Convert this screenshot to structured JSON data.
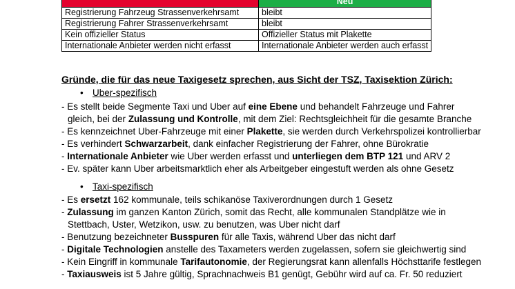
{
  "table": {
    "header": [
      "",
      "Neu"
    ],
    "rows": [
      [
        "Registrierung Fahrzeug Strassenverkehrsamt",
        "bleibt"
      ],
      [
        "Registrierung Fahrer Strassenverkehrsamt",
        "bleibt"
      ],
      [
        "Kein offizieller Status",
        "Offizieller Status mit Plakette"
      ],
      [
        "Internationale Anbieter werden nicht erfasst",
        "Internationale Anbieter werden auch erfasst"
      ]
    ]
  },
  "heading": "Gründe, die für das neue Taxigesetz sprechen, aus Sicht der TSZ, Taxisektion Zürich:",
  "sections": [
    {
      "bullet": "•",
      "title": "Uber-spezifisch",
      "lines": [
        {
          "indent": false,
          "segments": [
            {
              "t": "- Es stellt beide Segmente Taxi und Uber auf ",
              "b": false
            },
            {
              "t": "eine Ebene",
              "b": true
            },
            {
              "t": " und behandelt Fahrzeuge und Fahrer",
              "b": false
            }
          ]
        },
        {
          "indent": true,
          "segments": [
            {
              "t": "gleich, bei der ",
              "b": false
            },
            {
              "t": "Zulassung und Kontrolle",
              "b": true
            },
            {
              "t": ", mit dem Ziel: Rechtsgleichheit für die gesamte Branche",
              "b": false
            }
          ]
        },
        {
          "indent": false,
          "segments": [
            {
              "t": "- Es kennzeichnet Uber-Fahrzeuge mit einer ",
              "b": false
            },
            {
              "t": "Plakette",
              "b": true
            },
            {
              "t": ", sie werden durch Verkehrspolizei kontrollierbar",
              "b": false
            }
          ]
        },
        {
          "indent": false,
          "segments": [
            {
              "t": "- Es verhindert ",
              "b": false
            },
            {
              "t": "Schwarzarbeit",
              "b": true
            },
            {
              "t": ", dank einfacher Registrierung der Fahrer, ohne Bürokratie",
              "b": false
            }
          ]
        },
        {
          "indent": false,
          "segments": [
            {
              "t": "- ",
              "b": false
            },
            {
              "t": "Internationale Anbieter",
              "b": true
            },
            {
              "t": " wie Uber werden erfasst und ",
              "b": false
            },
            {
              "t": "unterliegen dem BTP 121",
              "b": true
            },
            {
              "t": " und ARV 2",
              "b": false
            }
          ]
        },
        {
          "indent": false,
          "segments": [
            {
              "t": "- Ev. später kann Uber arbeitsmarktlich eher als Arbeitgeber eingestuft werden als ohne Gesetz",
              "b": false
            }
          ]
        }
      ]
    },
    {
      "bullet": "•",
      "title": "Taxi-spezifisch",
      "lines": [
        {
          "indent": false,
          "segments": [
            {
              "t": "- Es ",
              "b": false
            },
            {
              "t": "ersetzt",
              "b": true
            },
            {
              "t": " 162 kommunale, teils schikanöse Taxiverordnungen durch 1 Gesetz",
              "b": false
            }
          ]
        },
        {
          "indent": false,
          "segments": [
            {
              "t": "- ",
              "b": false
            },
            {
              "t": "Zulassung",
              "b": true
            },
            {
              "t": " im ganzen Kanton Zürich, somit das Recht, alle kommunalen Standplätze wie in",
              "b": false
            }
          ]
        },
        {
          "indent": true,
          "segments": [
            {
              "t": "Stettbach, Uster, Wetzikon, usw. zu benutzen, was Uber nicht darf",
              "b": false
            }
          ]
        },
        {
          "indent": false,
          "segments": [
            {
              "t": "- Benutzung bezeichneter ",
              "b": false
            },
            {
              "t": "Busspuren",
              "b": true
            },
            {
              "t": " für alle Taxis, während Uber das nicht darf",
              "b": false
            }
          ]
        },
        {
          "indent": false,
          "segments": [
            {
              "t": "- ",
              "b": false
            },
            {
              "t": "Digitale Technologien",
              "b": true
            },
            {
              "t": " anstelle des Taxameters werden zugelassen, sofern sie gleichwertig sind",
              "b": false
            }
          ]
        },
        {
          "indent": false,
          "segments": [
            {
              "t": "- Kein Eingriff in kommunale ",
              "b": false
            },
            {
              "t": "Tarifautonomie",
              "b": true
            },
            {
              "t": ", der Regierungsrat kann allenfalls Höchsttarife festlegen",
              "b": false
            }
          ]
        },
        {
          "indent": false,
          "segments": [
            {
              "t": "- ",
              "b": false
            },
            {
              "t": "Taxiausweis",
              "b": true
            },
            {
              "t": " ist 5 Jahre gültig, Sprachnachweis B1 genügt, Gebühr wird auf ca. Fr. 50 reduziert",
              "b": false
            }
          ]
        }
      ]
    }
  ]
}
